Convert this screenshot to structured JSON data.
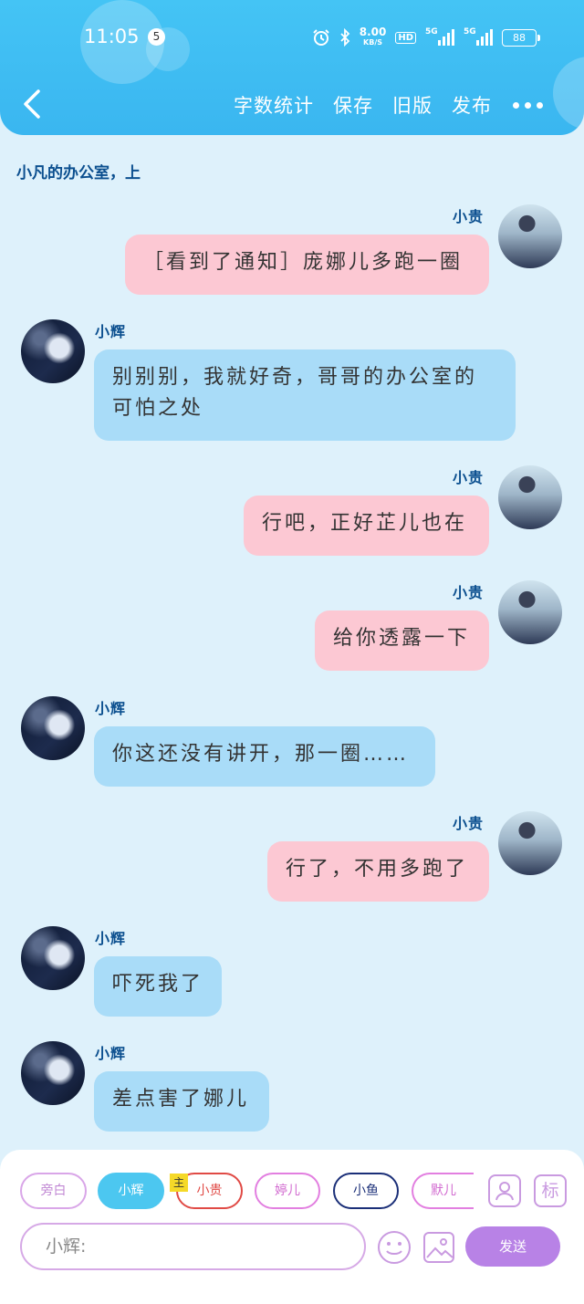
{
  "status_bar": {
    "time": "11:05",
    "notification_count": "5",
    "net_speed": "8.00",
    "net_speed_unit": "KB/S",
    "hd": "HD",
    "signal_1": "5G",
    "signal_2": "5G",
    "battery": "88"
  },
  "header": {
    "actions": [
      "字数统计",
      "保存",
      "旧版",
      "发布"
    ]
  },
  "chapter_title": "小凡的办公室，上",
  "messages": [
    {
      "side": "right",
      "sender": "小贵",
      "text": "［看到了通知］庞娜儿多跑一圈"
    },
    {
      "side": "left",
      "sender": "小辉",
      "text": "别别别，我就好奇，哥哥的办公室的可怕之处"
    },
    {
      "side": "right",
      "sender": "小贵",
      "text": "行吧，正好芷儿也在"
    },
    {
      "side": "right",
      "sender": "小贵",
      "text": "给你透露一下"
    },
    {
      "side": "left",
      "sender": "小辉",
      "text": "你这还没有讲开，那一圈……"
    },
    {
      "side": "right",
      "sender": "小贵",
      "text": "行了，不用多跑了"
    },
    {
      "side": "left",
      "sender": "小辉",
      "text": "吓死我了"
    },
    {
      "side": "left",
      "sender": "小辉",
      "text": "差点害了娜儿"
    }
  ],
  "composer": {
    "roles": [
      "旁白",
      "小辉",
      "小贵",
      "婷儿",
      "小鱼",
      "默儿"
    ],
    "main_tag": "主",
    "mark_label": "标",
    "input_value": "小辉:",
    "send_label": "发送"
  },
  "colors": {
    "header": "#3ab6f0",
    "background": "#def1fb",
    "bubble_right": "#fcc8d3",
    "bubble_left": "#a9dcf8",
    "send_button": "#b882e6"
  }
}
